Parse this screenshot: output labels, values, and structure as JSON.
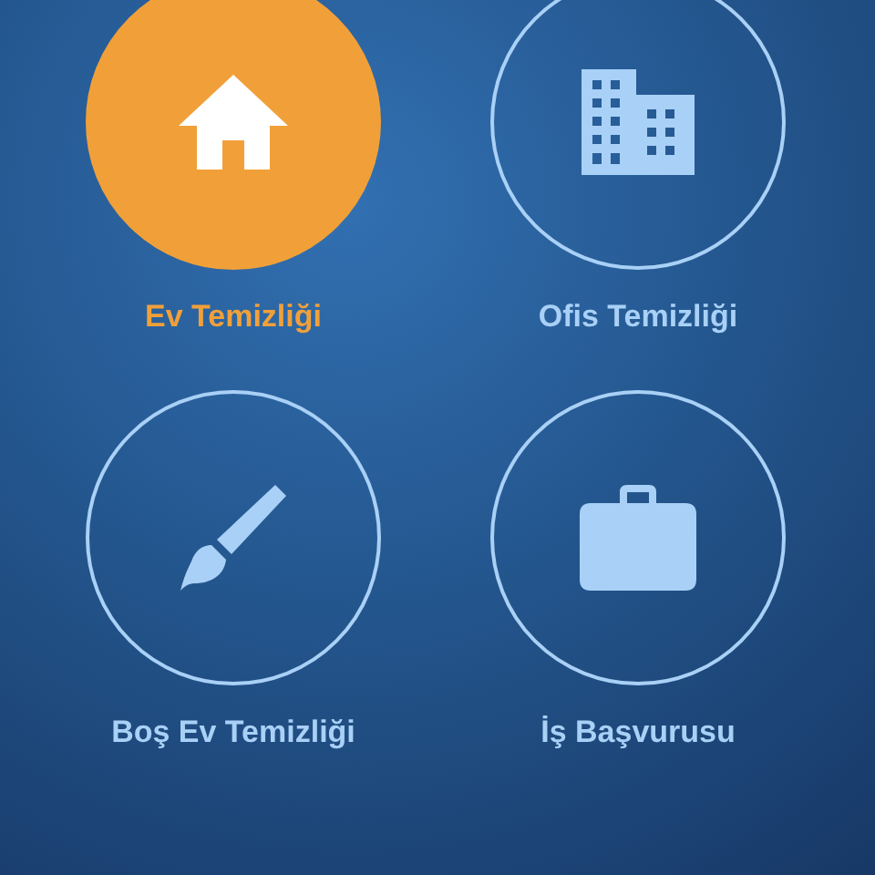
{
  "services": [
    {
      "label": "Ev Temizliği",
      "selected": true,
      "kind": "house"
    },
    {
      "label": "Ofis Temizliği",
      "selected": false,
      "kind": "building"
    },
    {
      "label": "Boş Ev Temizliği",
      "selected": false,
      "kind": "brush"
    },
    {
      "label": "İş Başvurusu",
      "selected": false,
      "kind": "briefcase"
    }
  ]
}
